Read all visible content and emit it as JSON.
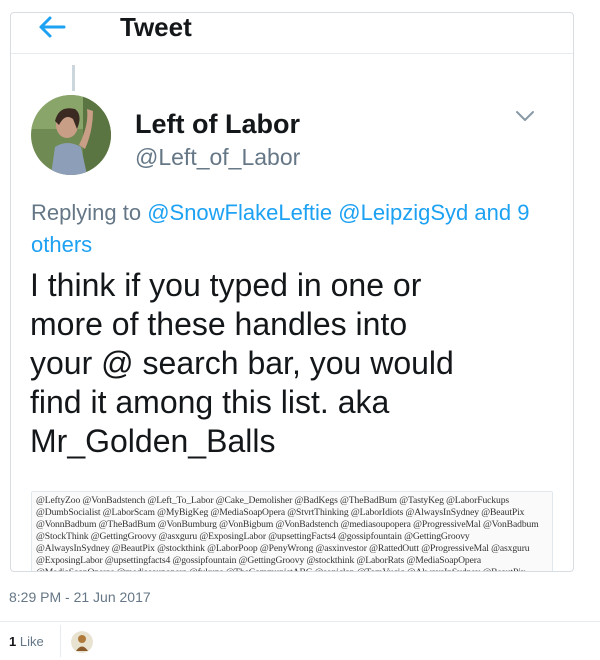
{
  "header": {
    "title": "Tweet"
  },
  "tweet": {
    "display_name": "Left of Labor",
    "handle": "@Left_of_Labor",
    "replying_prefix": "Replying to ",
    "replying_mentions": [
      "@SnowFlakeLeftie",
      "@LeipzigSyd"
    ],
    "replying_others": "and 9 others",
    "text": "I think if you typed in one or\nmore of these handles into\nyour @ search bar, you would\nfind it among this list. aka\nMr_Golden_Balls",
    "media_text": "@LeftyZoo @VonBadstench @Left_To_Labor @Cake_Demolisher @BadKegs @TheBadBum @TastyKeg @LaborFuckups\n@DumbSocialist @LaborScam @MyBigKeg @MediaSoapOpera @StvrtThinking @LaborIdiots @AlwaysInSydney @BeautPix\n@VonnBadbum @TheBadBum @VonBumburg @VonBigbum @VonBadstench @mediasoupopera @ProgressiveMal @VonBadbum\n@StockThink @GettingGroovy @asxguru @ExposingLabor @upsettingFacts4 @gossipfountain @GettingGroovy\n@AlwaysInSydney @BeautPix @stockthink @LaborPoop @PenyWrong @asxinvestor @RattedOutt @ProgressiveMal @asxguru\n@ExposingLabor @upsettingfacts4 @gossipfountain @GettingGroovy @stockthink @LaborRats @MediaSoapOpera\n@MediaSoapOperas @mediasoupopera @fukups @TheCommunistABC @soniclap @TomVucic @AlwaysInSydney @BeautPix\n@SonicSalsa @VucicT @SlamSalsa @StvrtThinking @VonBadBurn @LaborLeft @LaborFarm @VonBadbreath @LaborZoo",
    "timestamp": "8:29 PM - 21 Jun 2017",
    "likes_count": "1",
    "likes_label": "Like"
  },
  "colors": {
    "link": "#1da1f2",
    "muted": "#657786",
    "text": "#14171a",
    "border": "#e6ecf0"
  },
  "icons": {
    "back": "arrow-left-icon",
    "menu": "chevron-down-icon"
  }
}
